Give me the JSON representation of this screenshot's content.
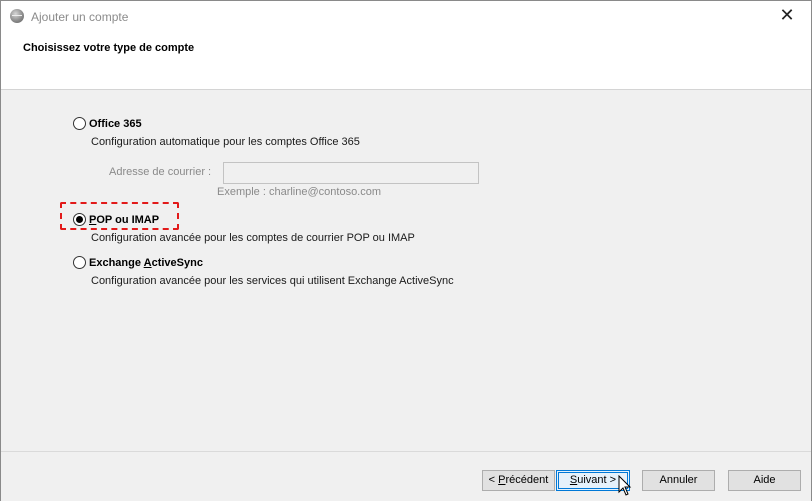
{
  "window": {
    "title": "Ajouter un compte",
    "close_glyph": "✕"
  },
  "header": {
    "title": "Choisissez votre type de compte"
  },
  "options": {
    "office365": {
      "label": "Office 365",
      "description": "Configuration automatique pour les comptes Office 365",
      "email_label": "Adresse de courrier :",
      "email_value": "",
      "example": "Exemple : charline@contoso.com",
      "selected": false
    },
    "pop_imap": {
      "label_accel": "P",
      "label_rest": "OP ou IMAP",
      "description": "Configuration avancée pour les comptes de courrier POP ou IMAP",
      "selected": true
    },
    "exchange": {
      "label_before": "Exchange ",
      "label_accel": "A",
      "label_rest": "ctiveSync",
      "description": "Configuration avancée pour les services qui utilisent Exchange ActiveSync",
      "selected": false
    }
  },
  "highlight_color": "#e21a1a",
  "buttons": {
    "back_prefix": "< ",
    "back_accel": "P",
    "back_rest": "récédent",
    "next_accel": "S",
    "next_rest": "uivant >",
    "cancel": "Annuler",
    "help": "Aide"
  },
  "icons": {
    "title_icon": "outlook-globe-icon",
    "cursor": "mouse-pointer-icon"
  }
}
